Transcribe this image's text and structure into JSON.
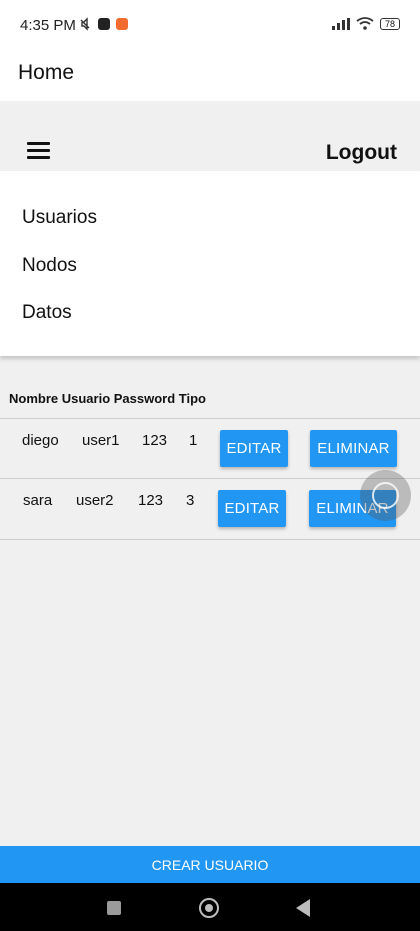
{
  "status_bar": {
    "time": "4:35 PM",
    "battery": "78"
  },
  "app_bar": {
    "title": "Home"
  },
  "header": {
    "logout_label": "Logout"
  },
  "menu": {
    "items": [
      "Usuarios",
      "Nodos",
      "Datos"
    ]
  },
  "table": {
    "header": "Nombre Usuario Password Tipo",
    "rows": [
      {
        "nombre": "diego",
        "usuario": "user1",
        "password": "123",
        "tipo": "1"
      },
      {
        "nombre": "sara",
        "usuario": "user2",
        "password": "123",
        "tipo": "3"
      }
    ],
    "edit_label": "EDITAR",
    "delete_label": "ELIMINAR"
  },
  "footer": {
    "create_label": "CREAR USUARIO"
  },
  "colors": {
    "primary": "#2196f3",
    "background": "#f0f0f0"
  }
}
